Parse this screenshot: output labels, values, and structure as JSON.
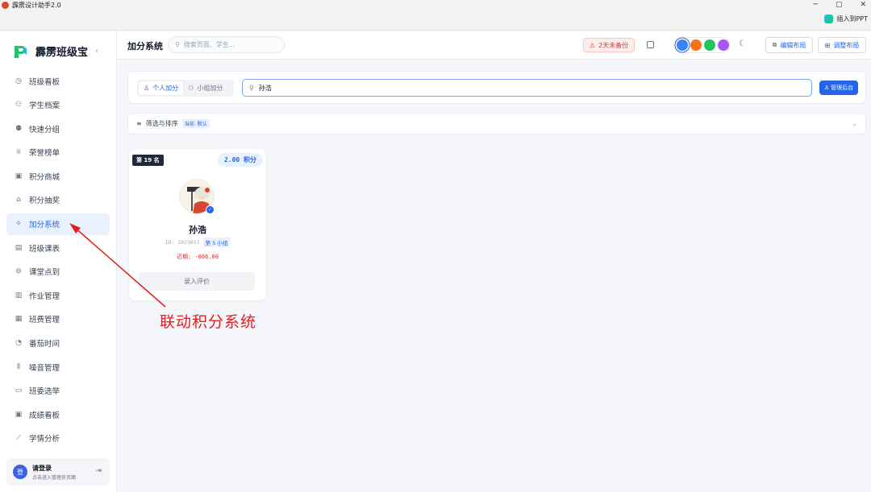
{
  "window": {
    "title": "霹雳设计助手2.0",
    "controls": {
      "minimize": "─",
      "maximize": "▢",
      "close": "✕"
    },
    "insert_ppt": "插入到PPT"
  },
  "sidebar": {
    "brand": "霹雳班级宝",
    "collapse_icon": "‹",
    "items": [
      {
        "label": "班级看板",
        "icon": "◷"
      },
      {
        "label": "学生档案",
        "icon": "⚇"
      },
      {
        "label": "快速分组",
        "icon": "⚉"
      },
      {
        "label": "荣誉榜单",
        "icon": "♕"
      },
      {
        "label": "积分商城",
        "icon": "▣"
      },
      {
        "label": "积分抽奖",
        "icon": "⌂"
      },
      {
        "label": "加分系统",
        "icon": "✧"
      },
      {
        "label": "班级课表",
        "icon": "▤"
      },
      {
        "label": "课堂点到",
        "icon": "⊖"
      },
      {
        "label": "作业管理",
        "icon": "▥"
      },
      {
        "label": "班费管理",
        "icon": "▦"
      },
      {
        "label": "番茄时间",
        "icon": "◔"
      },
      {
        "label": "噪音管理",
        "icon": "⦀"
      },
      {
        "label": "班委选举",
        "icon": "▭"
      },
      {
        "label": "成绩看板",
        "icon": "▣"
      },
      {
        "label": "学情分析",
        "icon": "⟋"
      }
    ],
    "active_index": 6,
    "login": {
      "avatar_letter": "登",
      "title": "请登录",
      "subtitle": "点击进入管理员页面",
      "logout_icon": "⇥"
    }
  },
  "topbar": {
    "title": "加分系统",
    "search_placeholder": "搜索页面、学生...",
    "backup_warning": "2天未备份",
    "theme_colors": [
      "#3b82f6",
      "#f97316",
      "#22c55e",
      "#a855f7"
    ],
    "dark_mode_icon": "☾",
    "edit_layout": "编辑布局",
    "adjust_layout": "调整布局"
  },
  "toolbar": {
    "tabs": [
      {
        "label": "个人加分",
        "icon": "♙"
      },
      {
        "label": "小组加分",
        "icon": "⚇"
      }
    ],
    "active_tab": 0,
    "search_value": "孙浩",
    "admin_button": "管理后台"
  },
  "filter": {
    "label": "筛选与排序",
    "tag": "当前: 默认"
  },
  "student_card": {
    "rank": "第 19 名",
    "score": "2.00 积分",
    "name": "孙浩",
    "id": "ID: 2023017",
    "group": "第 5 小组",
    "recent": "近期: -866.00",
    "action": "录入评价"
  },
  "annotation": {
    "text": "联动积分系统",
    "color": "#e02020"
  }
}
